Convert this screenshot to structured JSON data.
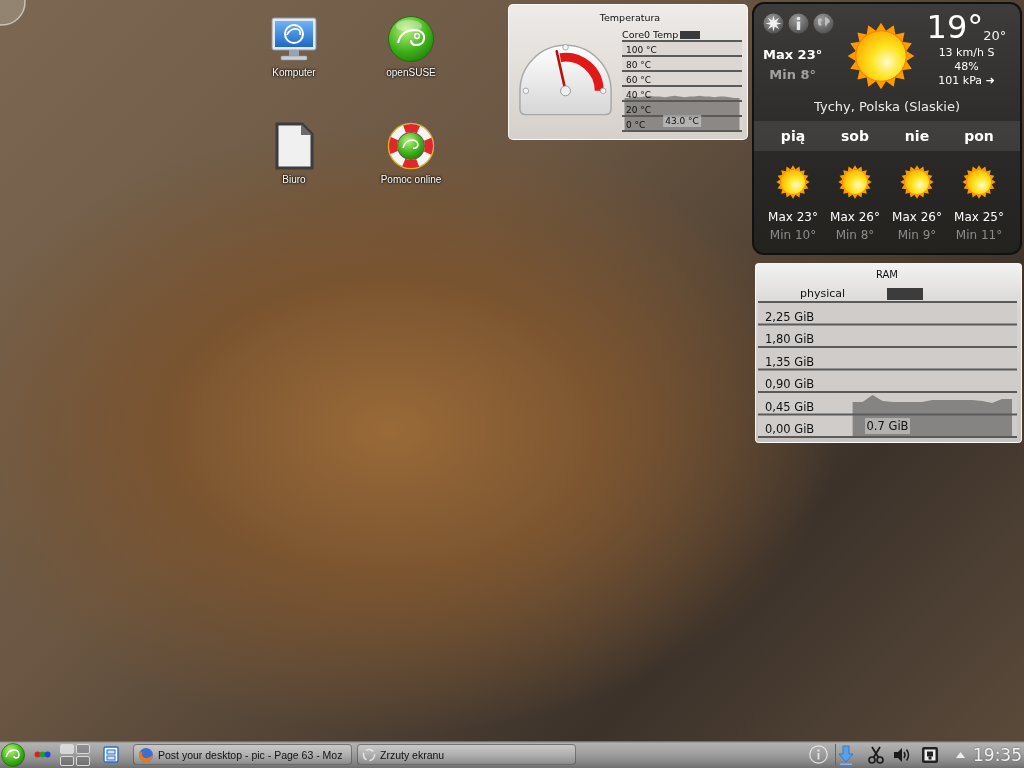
{
  "desktop_icons": [
    {
      "label": "Komputer",
      "kind": "monitor"
    },
    {
      "label": "openSUSE",
      "kind": "orb"
    },
    {
      "label": "Biuro",
      "kind": "document"
    },
    {
      "label": "Pomoc online",
      "kind": "lifebuoy"
    }
  ],
  "temperature_widget": {
    "title": "Temperatura",
    "gauge": {
      "level": 0.43
    },
    "reading": "43.0 °C",
    "chart_data": {
      "type": "area",
      "grid": true,
      "series": [
        {
          "name": "Core0 Temp",
          "color": "#3a3a3a",
          "values": [
            44,
            44,
            46,
            45,
            46,
            47,
            46,
            46,
            45,
            46,
            47,
            46,
            45,
            46,
            46,
            47,
            46,
            46,
            45,
            46,
            46,
            45,
            44,
            44
          ]
        }
      ],
      "ylim": [
        0,
        120
      ],
      "yticks": [
        {
          "value": 0,
          "label": "0 °C"
        },
        {
          "value": 20,
          "label": "20 °C"
        },
        {
          "value": 40,
          "label": "40 °C"
        },
        {
          "value": 60,
          "label": "60 °C"
        },
        {
          "value": 80,
          "label": "80 °C"
        },
        {
          "value": 100,
          "label": "100 °C"
        }
      ]
    }
  },
  "weather_widget": {
    "max": "Max 23°",
    "min": "Min 8°",
    "temperature": "19°",
    "feels_like": "20°",
    "wind": "13 km/h S",
    "humidity": "48%",
    "pressure": "101 kPa ➜",
    "location": "Tychy, Polska (Slaskie)",
    "forecast": [
      {
        "day": "pią",
        "max": "Max 23°",
        "min": "Min 10°"
      },
      {
        "day": "sob",
        "max": "Max 26°",
        "min": "Min 8°"
      },
      {
        "day": "nie",
        "max": "Max 26°",
        "min": "Min 9°"
      },
      {
        "day": "pon",
        "max": "Max 25°",
        "min": "Min 11°"
      }
    ]
  },
  "ram_widget": {
    "title": "RAM",
    "reading": "0.7 GiB",
    "chart_data": {
      "type": "area",
      "grid": true,
      "series": [
        {
          "name": "physical",
          "color": "#3c3c3c",
          "values": [
            null,
            null,
            null,
            null,
            null,
            null,
            null,
            null,
            null,
            0.7,
            0.7,
            0.84,
            0.72,
            0.7,
            0.7,
            0.7,
            0.7,
            0.74,
            0.74,
            0.74,
            0.74,
            0.74,
            0.72,
            0.68,
            0.76,
            0.76
          ]
        }
      ],
      "ylim": [
        0,
        2.7
      ],
      "yticks": [
        {
          "value": 0,
          "label": "0,00 GiB"
        },
        {
          "value": 0.45,
          "label": "0,45 GiB"
        },
        {
          "value": 0.9,
          "label": "0,90 GiB"
        },
        {
          "value": 1.35,
          "label": "1,35 GiB"
        },
        {
          "value": 1.8,
          "label": "1,80 GiB"
        },
        {
          "value": 2.25,
          "label": "2,25 GiB"
        }
      ]
    }
  },
  "taskbar": {
    "pager": [
      {
        "selected": true
      },
      {
        "selected": false
      },
      {
        "selected": false
      },
      {
        "selected": false
      }
    ],
    "tasks": [
      {
        "label": "Post your desktop - pic - Page 63 - Moz",
        "kind": "browser"
      },
      {
        "label": "Zrzuty ekranu",
        "kind": "loading"
      }
    ],
    "clock": "19:35"
  }
}
